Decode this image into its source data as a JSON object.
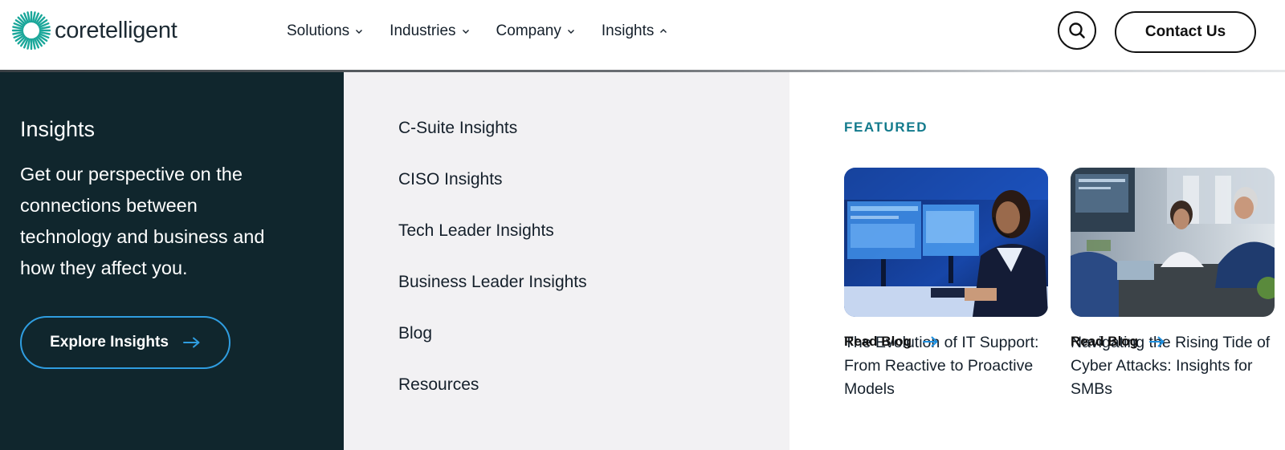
{
  "brand": {
    "name": "coretelligent",
    "accent": "#1aa79a"
  },
  "nav": {
    "items": [
      {
        "label": "Solutions",
        "icon": "chevron-down-icon"
      },
      {
        "label": "Industries",
        "icon": "chevron-down-icon"
      },
      {
        "label": "Company",
        "icon": "chevron-down-icon"
      },
      {
        "label": "Insights",
        "icon": "chevron-up-icon"
      }
    ],
    "search_icon": "search-icon",
    "contact_label": "Contact Us"
  },
  "mega_menu": {
    "intro": {
      "title": "Insights",
      "description": "Get our perspective on the connections between technology and business and how they affect you.",
      "cta_label": "Explore Insights",
      "bg_color": "#10262d",
      "cta_border_color": "#2f9de0"
    },
    "links": [
      "C-Suite Insights",
      "CISO Insights",
      "Tech Leader Insights",
      "Business Leader Insights",
      "Blog",
      "Resources"
    ],
    "featured": {
      "label": "FEATURED",
      "label_color": "#127a8c",
      "cards": [
        {
          "title": "The Evolution of IT Support: From Reactive to Proactive Models",
          "link_label": "Read Blog",
          "image": "support-agent-with-headset-at-monitors-photo"
        },
        {
          "title": "Navigating the Rising Tide of Cyber Attacks: Insights for SMBs",
          "link_label": "Read Blog",
          "image": "business-team-meeting-in-office-photo"
        }
      ]
    }
  }
}
